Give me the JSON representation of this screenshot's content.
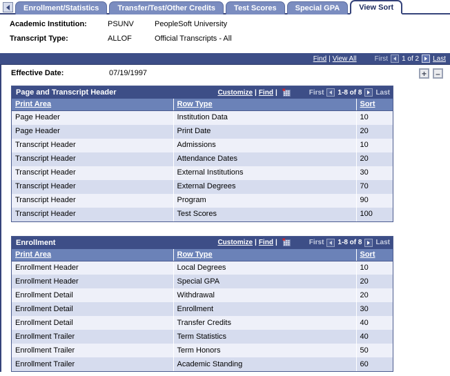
{
  "tabs": [
    {
      "label": "Enrollment/Statistics",
      "active": false
    },
    {
      "label": "Transfer/Test/Other Credits",
      "active": false
    },
    {
      "label": "Test Scores",
      "active": false
    },
    {
      "label": "Special GPA",
      "active": false
    },
    {
      "label": "View Sort",
      "active": true
    }
  ],
  "header": {
    "institution_label": "Academic Institution:",
    "institution_code": "PSUNV",
    "institution_name": "PeopleSoft University",
    "transcript_label": "Transcript Type:",
    "transcript_code": "ALLOF",
    "transcript_name": "Official Transcripts - All"
  },
  "levelbar": {
    "find": "Find",
    "separator": "|",
    "view_all": "View All",
    "first": "First",
    "counter": "1 of 2",
    "last": "Last"
  },
  "rowctl": {
    "add_label": "+",
    "delete_label": "–"
  },
  "effective": {
    "label": "Effective Date:",
    "value": "07/19/1997"
  },
  "grids": [
    {
      "title": "Page and Transcript Header",
      "customize": "Customize",
      "separator": "|",
      "find": "Find",
      "download_icon": "spreadsheet-download-icon",
      "first": "First",
      "counter": "1-8 of 8",
      "last": "Last",
      "columns": [
        "Print Area",
        "Row Type",
        "Sort"
      ],
      "rows": [
        [
          "Page Header",
          "Institution Data",
          "10"
        ],
        [
          "Page Header",
          "Print Date",
          "20"
        ],
        [
          "Transcript Header",
          "Admissions",
          "10"
        ],
        [
          "Transcript Header",
          "Attendance Dates",
          "20"
        ],
        [
          "Transcript Header",
          "External Institutions",
          "30"
        ],
        [
          "Transcript Header",
          "External Degrees",
          "70"
        ],
        [
          "Transcript Header",
          "Program",
          "90"
        ],
        [
          "Transcript Header",
          "Test Scores",
          "100"
        ]
      ]
    },
    {
      "title": "Enrollment",
      "customize": "Customize",
      "separator": "|",
      "find": "Find",
      "download_icon": "spreadsheet-download-icon",
      "first": "First",
      "counter": "1-8 of 8",
      "last": "Last",
      "columns": [
        "Print Area",
        "Row Type",
        "Sort"
      ],
      "rows": [
        [
          "Enrollment Header",
          "Local Degrees",
          "10"
        ],
        [
          "Enrollment Header",
          "Special GPA",
          "20"
        ],
        [
          "Enrollment Detail",
          "Withdrawal",
          "20"
        ],
        [
          "Enrollment Detail",
          "Enrollment",
          "30"
        ],
        [
          "Enrollment Detail",
          "Transfer Credits",
          "40"
        ],
        [
          "Enrollment Trailer",
          "Term Statistics",
          "40"
        ],
        [
          "Enrollment Trailer",
          "Term Honors",
          "50"
        ],
        [
          "Enrollment Trailer",
          "Academic Standing",
          "60"
        ]
      ]
    }
  ],
  "colors": {
    "header_blue": "#3d4e87",
    "column_header_blue": "#6b82b8",
    "tab_blue": "#7b8dc0",
    "row_odd": "#eef0f9",
    "row_even": "#d6dcee"
  }
}
